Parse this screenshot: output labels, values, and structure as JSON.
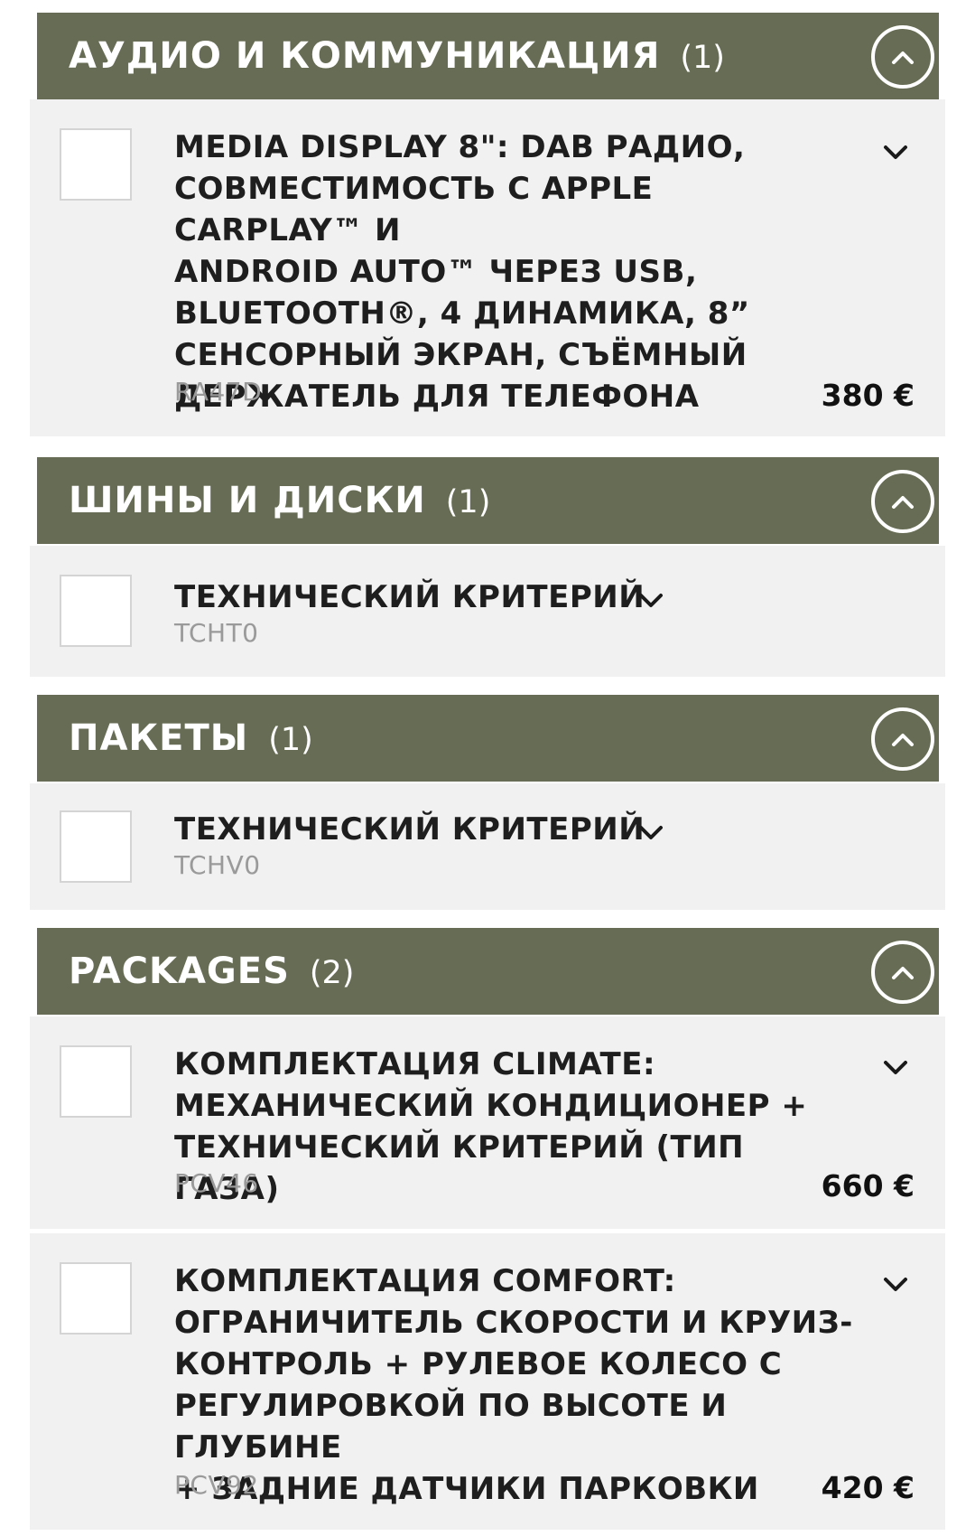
{
  "sections": [
    {
      "title": "АУДИО И КОММУНИКАЦИЯ",
      "count": "(1)",
      "items": [
        {
          "title_lines": [
            "MEDIA DISPLAY 8\": DAB РАДИО,",
            "СОВМЕСТИМОСТЬ С APPLE CARPLAY™ И",
            "ANDROID AUTO™ ЧЕРЕЗ USB,",
            "BLUETOOTH®, 4 ДИНАМИКА, 8”",
            "СЕНСОРНЫЙ ЭКРАН, СЪЁМНЫЙ",
            "ДЕРЖАТЕЛЬ ДЛЯ ТЕЛЕФОНА"
          ],
          "code": "RA47D",
          "price": "380 €"
        }
      ]
    },
    {
      "title": "ШИНЫ И ДИСКИ",
      "count": "(1)",
      "items": [
        {
          "title_lines": [
            "ТЕХНИЧЕСКИЙ КРИТЕРИЙ"
          ],
          "code": "TCHT0",
          "price": ""
        }
      ]
    },
    {
      "title": "ПАКЕТЫ",
      "count": "(1)",
      "items": [
        {
          "title_lines": [
            "ТЕХНИЧЕСКИЙ КРИТЕРИЙ"
          ],
          "code": "TCHV0",
          "price": ""
        }
      ]
    },
    {
      "title": "PACKAGES",
      "count": "(2)",
      "items": [
        {
          "title_lines": [
            "КОМПЛЕКТАЦИЯ CLIMATE:",
            "МЕХАНИЧЕСКИЙ КОНДИЦИОНЕР +",
            "ТЕХНИЧЕСКИЙ КРИТЕРИЙ (ТИП ГАЗА)"
          ],
          "code": "PCV46",
          "price": "660 €"
        },
        {
          "title_lines": [
            "КОМПЛЕКТАЦИЯ COMFORT:",
            "ОГРАНИЧИТЕЛЬ СКОРОСТИ И КРУИЗ-",
            "КОНТРОЛЬ + РУЛЕВОЕ КОЛЕСО С",
            "РЕГУЛИРОВКОЙ ПО ВЫСОТЕ И ГЛУБИНЕ",
            "+ ЗАДНИЕ ДАТЧИКИ ПАРКОВКИ"
          ],
          "code": "PCV92",
          "price": "420 €"
        }
      ]
    }
  ],
  "icons": {
    "collapse": "chevron-up-circle-icon",
    "expand": "chevron-down-icon"
  },
  "colors": {
    "header_bg": "#676d54",
    "card_bg": "#f1f1f1",
    "code_text": "#9a9a9a"
  }
}
